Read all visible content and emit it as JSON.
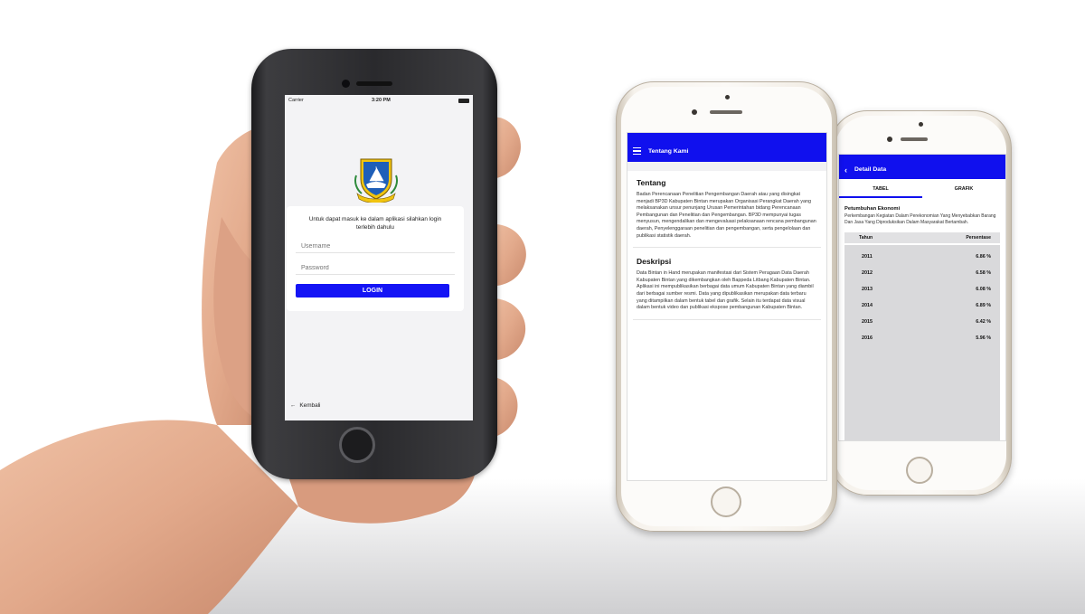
{
  "login_screen": {
    "status": {
      "carrier": "Carrier",
      "time": "3:20 PM"
    },
    "intro": "Untuk dapat masuk ke dalam aplikasi silahkan login terlebih dahulu",
    "username_placeholder": "Username",
    "password_placeholder": "Password",
    "login_button": "LOGIN",
    "back_link": "Kembali",
    "back_icon": "arrow-left-icon"
  },
  "about_screen": {
    "title": "Tentang Kami",
    "menu_icon": "hamburger-menu-icon",
    "section1_title": "Tentang",
    "section1_text": "Badan Perencanaan Penelitian Pengembangan Daerah atau yang disingkat menjadi BP3D Kabupaten Bintan merupakan Organisasi Perangkat Daerah yang melaksanakan unsur penunjang Urusan Pemerintahan bidang Perencanaan Pembangunan dan Penelitian dan Pengembangan. BP3D mempunyai tugas menyusun, mengendalikan dan mengevaluasi pelaksanaan rencana pembangunan daerah, Penyelenggaraan penelitian dan pengembangan, serta pengelolaan dan publikasi statistik daerah.",
    "section2_title": "Deskripsi",
    "section2_text": "Data Bintan in Hand merupakan manifestasi dari Sistem Peragaan Data Daerah Kabupaten Bintan yang dikembangkan oleh Bappeda Litbang Kabupaten Bintan. Aplikasi ini mempublikasikan berbagai data umum Kabupaten Bintan yang diambil dari berbagai sumber resmi. Data yang dipublikasikan merupakan data terbaru yang ditampilkan dalam bentuk tabel dan grafik. Selain itu terdapat data visual dalam bentuk video dan publikasi ekspose pembangunan Kabupaten Bintan."
  },
  "detail_screen": {
    "title": "Detail Data",
    "back_icon": "chevron-left-icon",
    "tabs": [
      "TABEL",
      "GRAFIK"
    ],
    "heading": "Petumbuhan Ekonomi",
    "subheading": "Perkembangan Kegiatan Dalam Perekonomian Yang Menyebabkan Barang Dan Jasa Yang Diproduksikan Dalam Masyarakat Bertambah.",
    "columns": [
      "Tahun",
      "Persentase"
    ],
    "rows": [
      {
        "year": "2011",
        "value": "6.86 %"
      },
      {
        "year": "2012",
        "value": "6.58 %"
      },
      {
        "year": "2013",
        "value": "6.08 %"
      },
      {
        "year": "2014",
        "value": "6.89 %"
      },
      {
        "year": "2015",
        "value": "6.42 %"
      },
      {
        "year": "2016",
        "value": "5.96 %"
      }
    ]
  },
  "colors": {
    "brand_blue": "#1010ee",
    "phone_black": "#2a2a2d",
    "phone_gold": "#f6f2ec",
    "skin": "#e0a587"
  }
}
